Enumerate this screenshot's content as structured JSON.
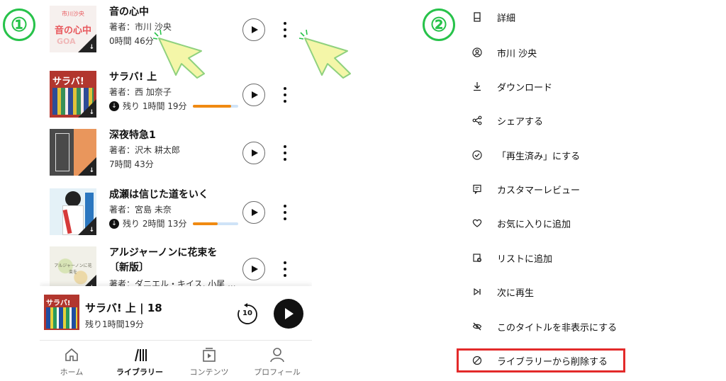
{
  "step_badges": [
    "①",
    "②"
  ],
  "library": {
    "books": [
      {
        "title": "音の心中",
        "author": "著者：市川 沙央",
        "meta": "0時間 46分",
        "downloaded": false,
        "progress": null,
        "cover": {
          "bg": "#f6f0ee",
          "top_text": "市川沙央",
          "main_text": "音の心中",
          "sub_text": "GOA",
          "accent": "#e8575c"
        }
      },
      {
        "title": "サラバ! 上",
        "author": "著者：西 加奈子",
        "meta": "残り 1時間 19分",
        "downloaded": true,
        "progress": 0.85,
        "cover": {
          "bg": "#b2362e",
          "top_text": "サラバ!",
          "main_text": "",
          "sub_text": "",
          "accent": "#1f4ea1"
        }
      },
      {
        "title": "深夜特急1",
        "author": "著者：沢木 耕太郎",
        "meta": "7時間 43分",
        "downloaded": false,
        "progress": null,
        "cover": {
          "bg": "#4a4a4a",
          "top_text": "",
          "main_text": "",
          "sub_text": "",
          "accent": "#e9965c"
        }
      },
      {
        "title": "成瀬は信じた道をいく",
        "author": "著者：宮島 未奈",
        "meta": "残り 2時間 13分",
        "downloaded": true,
        "progress": 0.55,
        "cover": {
          "bg": "#e4f1f7",
          "top_text": "",
          "main_text": "",
          "sub_text": "",
          "accent": "#2b77c0"
        }
      },
      {
        "title": "アルジャーノンに花束を",
        "title_line2": "〔新版〕",
        "author": "著者：ダニエル・キイス, 小尾 ...",
        "meta": "",
        "downloaded": false,
        "progress": null,
        "cover": {
          "bg": "#f1f0e8",
          "top_text": "",
          "main_text": "アルジャーノンに花束を",
          "sub_text": "",
          "accent": "#c9d7a4"
        }
      }
    ]
  },
  "mini_player": {
    "title": "サラバ! 上 | 18",
    "remaining": "残り1時間19分",
    "rewind_seconds": "10"
  },
  "bottom_nav": [
    {
      "label": "ホーム",
      "icon": "home-icon",
      "active": false
    },
    {
      "label": "ライブラリー",
      "icon": "library-icon",
      "active": true
    },
    {
      "label": "コンテンツ",
      "icon": "contents-icon",
      "active": false
    },
    {
      "label": "プロフィール",
      "icon": "profile-icon",
      "active": false
    }
  ],
  "context_menu": {
    "items": [
      {
        "label": "詳細",
        "icon": "book-detail-icon"
      },
      {
        "label": "市川 沙央",
        "icon": "author-icon"
      },
      {
        "label": "ダウンロード",
        "icon": "download-icon"
      },
      {
        "label": "シェアする",
        "icon": "share-icon"
      },
      {
        "label": "「再生済み」にする",
        "icon": "check-circle-icon"
      },
      {
        "label": "カスタマーレビュー",
        "icon": "review-icon"
      },
      {
        "label": "お気に入りに追加",
        "icon": "heart-icon"
      },
      {
        "label": "リストに追加",
        "icon": "list-add-icon"
      },
      {
        "label": "次に再生",
        "icon": "play-next-icon"
      },
      {
        "label": "このタイトルを非表示にする",
        "icon": "hide-icon"
      },
      {
        "label": "ライブラリーから削除する",
        "icon": "remove-icon"
      }
    ],
    "highlighted_item": "ライブラリーから削除する"
  },
  "colors": {
    "annotation_green": "#27c24a",
    "highlight_red": "#e32a2a",
    "progress_orange": "#f08a12",
    "progress_track": "#cfe3f7"
  }
}
